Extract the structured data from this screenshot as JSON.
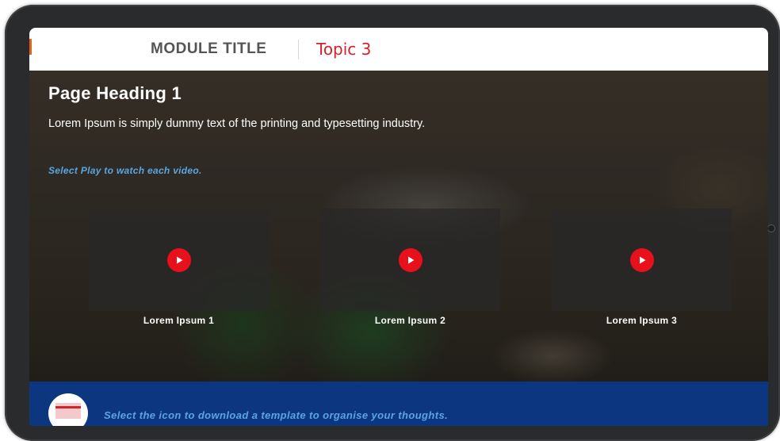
{
  "header": {
    "module_title": "MODULE TITLE",
    "topic": "Topic 3"
  },
  "content": {
    "page_heading": "Page Heading 1",
    "intro": "Lorem Ipsum is simply dummy text of the printing and typesetting industry.",
    "instruction": "Select Play to watch each video."
  },
  "videos": [
    {
      "label": "Lorem Ipsum 1",
      "icon": "play-icon"
    },
    {
      "label": "Lorem Ipsum 2",
      "icon": "play-icon"
    },
    {
      "label": "Lorem Ipsum 3",
      "icon": "play-icon"
    }
  ],
  "footer": {
    "text": "Select the icon to download a template to organise your thoughts.",
    "icon": "document-download-icon"
  },
  "colors": {
    "topic_red": "#d2232a",
    "play_red": "#e8101b",
    "instruction_blue": "#5aa6e0",
    "footer_navy": "#0c3680"
  }
}
